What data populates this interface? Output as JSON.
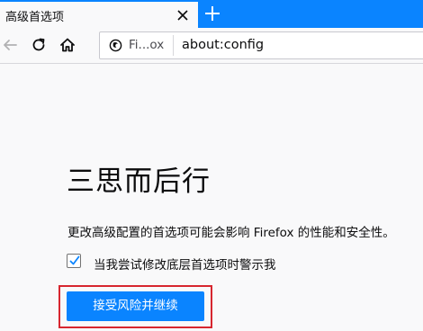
{
  "tab": {
    "title": "高级首选项",
    "close_icon": "close-icon",
    "new_tab_icon": "plus-icon"
  },
  "toolbar": {
    "back_icon": "arrow-left-icon",
    "reload_icon": "reload-icon",
    "home_icon": "home-icon"
  },
  "urlbar": {
    "identity_label": "Fi...ox",
    "identity_icon": "firefox-icon",
    "url": "about:config"
  },
  "warning": {
    "title": "三思而后行",
    "message": "更改高级配置的首选项可能会影响 Firefox 的性能和安全性。",
    "checkbox_label": "当我尝试修改底层首选项时警示我",
    "checkbox_checked": true,
    "accept_button_label": "接受风险并继续"
  },
  "colors": {
    "accent": "#0a84ff",
    "highlight_border": "#d7262f",
    "page_background": "#f9f9fa"
  }
}
